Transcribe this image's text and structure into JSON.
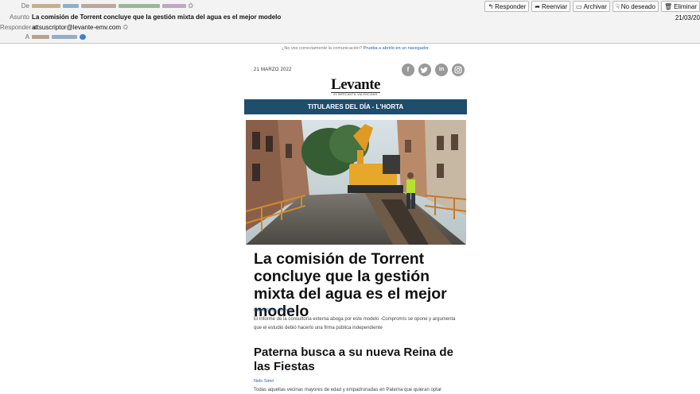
{
  "email": {
    "labels": {
      "from": "De",
      "subject": "Asunto",
      "reply_to": "Responder a",
      "to": "A"
    },
    "subject": "La comisión de Torrent concluye que la gestión mixta del agua es el mejor modelo",
    "reply_to": "attsuscriptor@levante-emv.com",
    "date": "21/03/20",
    "toolbar": {
      "reply": "Responder",
      "forward": "Reenviar",
      "archive": "Archivar",
      "junk": "No deseado",
      "delete": "Eliminar"
    }
  },
  "newsletter": {
    "notice": "¿No ves correctamente la comunicación?",
    "notice_link": "Prueba a abrirlo en un navegador.",
    "date": "21 MARZO 2022",
    "logo": "Levante",
    "logo_sub": "EL MERCANTIL VALENCIANO",
    "section_title": "TITULARES DEL DÍA - L'HORTA",
    "articles": [
      {
        "headline": "La comisión de Torrent concluye que la gestión mixta del agua es el mejor modelo",
        "author": "Laura Sena. Torrent",
        "summary": "El informe de la consultoría externa aboga por este modelo -Compromís se opone y argumenta que el estudio debió hacerlo una firma pública independiente"
      },
      {
        "headline": "Paterna busca a su nueva Reina de las Fiestas",
        "author": "Nelo Simó",
        "summary": "Todas aquellas vecinas mayores de edad y empadronadas en Paterna que quieran optar"
      }
    ]
  }
}
